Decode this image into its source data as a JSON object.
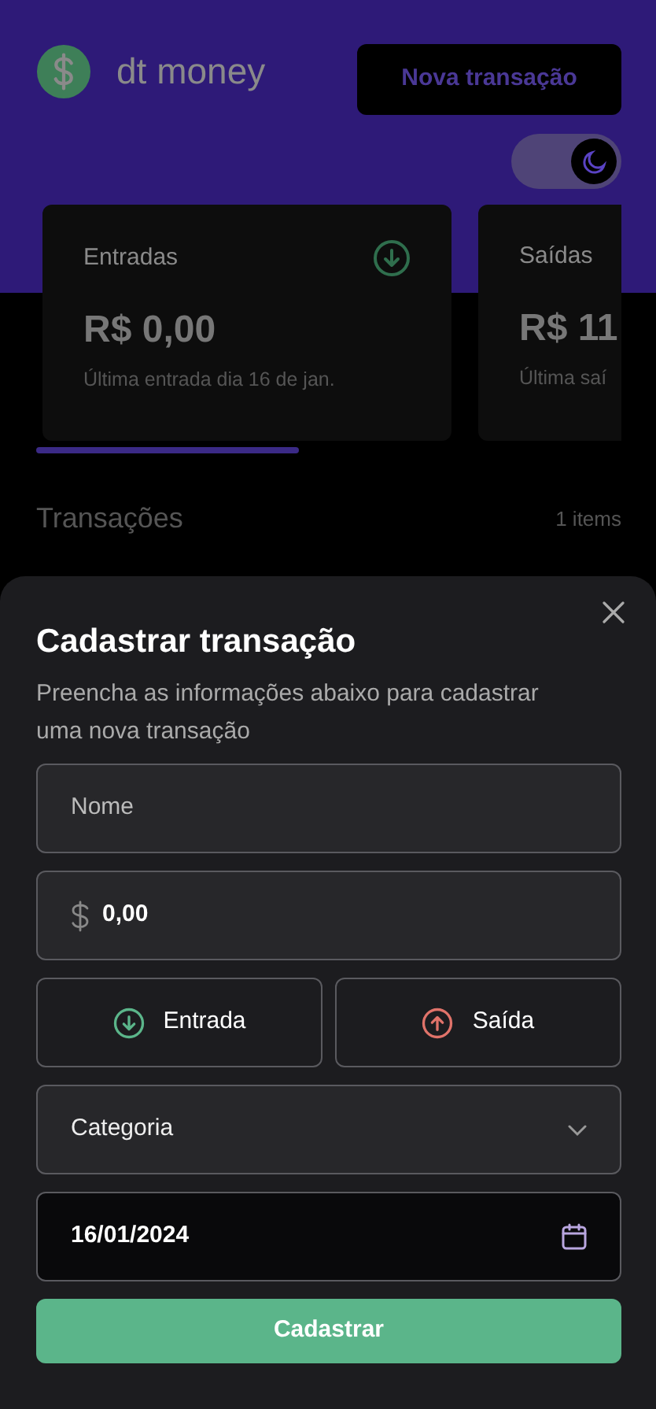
{
  "header": {
    "logo": "dt money",
    "new_button": "Nova transação",
    "theme_toggle": {
      "on": true
    }
  },
  "summary_cards": [
    {
      "kind": "income",
      "title": "Entradas",
      "amount": "R$ 0,00",
      "caption": "Última entrada dia 16 de jan."
    },
    {
      "kind": "expense",
      "title": "Saídas",
      "amount": "R$ 11",
      "caption": "Última saí"
    }
  ],
  "transactions": {
    "title": "Transações",
    "count": "1 items"
  },
  "modal": {
    "title": "Cadastrar transação",
    "description": "Preencha as informações abaixo para cadastrar uma nova transação",
    "name_field": {
      "placeholder": "Nome"
    },
    "price_field": {
      "value": "0,00"
    },
    "type_buttons": [
      {
        "kind": "income",
        "label": "Entrada",
        "selected": false
      },
      {
        "kind": "expense",
        "label": "Saída",
        "selected": false
      }
    ],
    "category_select": {
      "placeholder": "Categoria"
    },
    "date_field": {
      "value": "16/01/2024"
    },
    "submit": "Cadastrar"
  }
}
